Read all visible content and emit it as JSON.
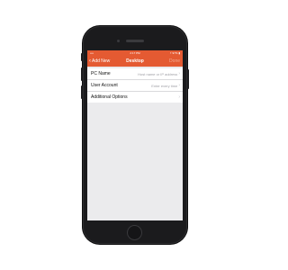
{
  "status_bar": {
    "left": "•••• ",
    "time": "2:17 PM",
    "right": "⚡ 97% ▮"
  },
  "nav": {
    "back_label": "Add New",
    "title": "Desktop",
    "done_label": "Done"
  },
  "form": {
    "rows": [
      {
        "label": "PC Name",
        "placeholder": "Host name or IP address"
      },
      {
        "label": "User Account",
        "placeholder": "Enter every time"
      },
      {
        "label": "Additional Options",
        "placeholder": ""
      }
    ]
  },
  "colors": {
    "accent": "#e45a32",
    "background": "#ebebed",
    "device": "#1b1b1d"
  },
  "icons": {
    "back": "chevron-left-icon",
    "disclosure": "chevron-right-icon"
  }
}
